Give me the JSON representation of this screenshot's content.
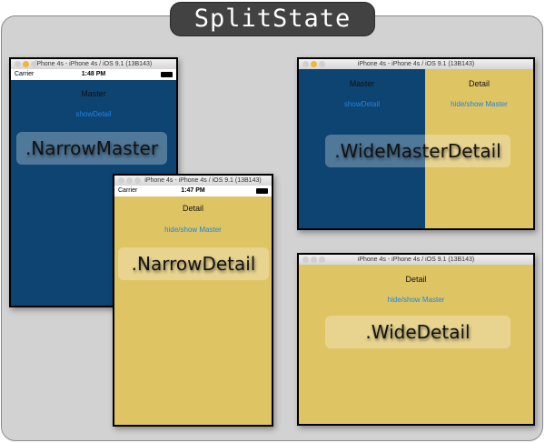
{
  "title": "SplitState",
  "colors": {
    "master": "#0d4472",
    "detail": "#dfc464",
    "link": "#1e84e6"
  },
  "window_title": "iPhone 4s - iPhone 4s / iOS 9.1 (13B143)",
  "status": {
    "carrier": "Carrier",
    "wifi_icon": "wifi-icon",
    "battery_icon": "battery-icon"
  },
  "narrow_master": {
    "time": "1:48 PM",
    "nav_title": "Master",
    "link": "showDetail",
    "state_label": ".NarrowMaster"
  },
  "narrow_detail": {
    "time": "1:47 PM",
    "nav_title": "Detail",
    "link": "hide/show Master",
    "state_label": ".NarrowDetail"
  },
  "wide_master_detail": {
    "master_title": "Master",
    "master_link": "showDetail",
    "detail_title": "Detail",
    "detail_link": "hide/show Master",
    "state_label": ".WideMasterDetail"
  },
  "wide_detail": {
    "nav_title": "Detail",
    "link": "hide/show Master",
    "state_label": ".WideDetail"
  }
}
